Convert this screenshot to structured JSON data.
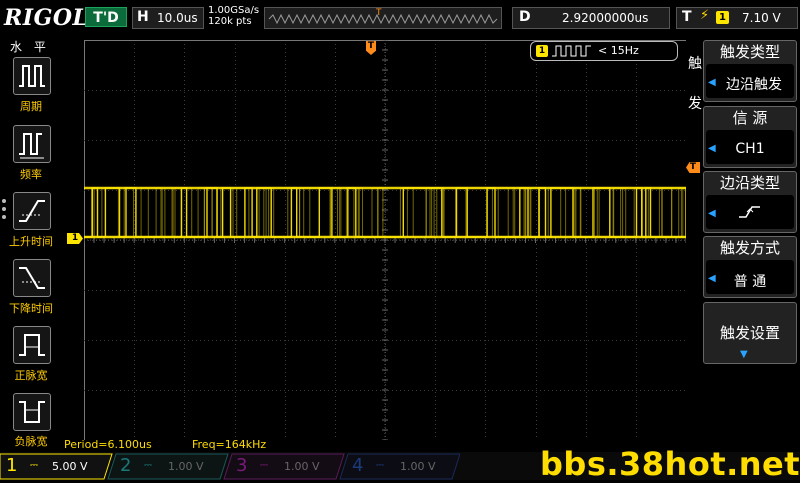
{
  "header": {
    "brand": "RIGOL",
    "run_status": "T'D",
    "hscale_letter": "H",
    "hscale_value": "10.0us",
    "sample_rate": "1.00GSa/s",
    "memory_points": "120k pts",
    "trigger_pos_marker": "T",
    "delay_letter": "D",
    "delay_value": "2.92000000us",
    "trigger_letter": "T",
    "trigger_channel": "1",
    "trigger_level": "7.10 V"
  },
  "left_menu": {
    "title": "水 平",
    "items": [
      {
        "label": "周期",
        "icon": "period-icon"
      },
      {
        "label": "频率",
        "icon": "frequency-icon"
      },
      {
        "label": "上升时间",
        "icon": "rise-time-icon"
      },
      {
        "label": "下降时间",
        "icon": "fall-time-icon"
      },
      {
        "label": "正脉宽",
        "icon": "positive-width-icon"
      },
      {
        "label": "负脉宽",
        "icon": "negative-width-icon"
      }
    ]
  },
  "screen": {
    "ch1_marker": "1",
    "trigger_time_marker": "T",
    "trigger_level_marker": "T",
    "counter": {
      "channel": "1",
      "value": "< 15Hz"
    }
  },
  "right_menu": {
    "vertical_label": "触\n发",
    "panels": [
      {
        "title": "触发类型",
        "value": "边沿触发"
      },
      {
        "title": "信 源",
        "value": "CH1"
      },
      {
        "title": "边沿类型",
        "value": ""
      },
      {
        "title": "触发方式",
        "value": "普 通"
      },
      {
        "title": "触发设置",
        "value": ""
      }
    ]
  },
  "measurements": {
    "period": "Period=6.100us",
    "freq": "Freq=164kHz"
  },
  "channels": [
    {
      "num": "1",
      "scale": "5.00 V",
      "color": "#ffe600",
      "active": true
    },
    {
      "num": "2",
      "scale": "1.00 V",
      "color": "#1a7a7a",
      "active": false
    },
    {
      "num": "3",
      "scale": "1.00 V",
      "color": "#7a1a7a",
      "active": false
    },
    {
      "num": "4",
      "scale": "1.00 V",
      "color": "#1a3a7a",
      "active": false
    }
  ],
  "watermark": "bbs.38hot.net",
  "colors": {
    "ch1": "#ffe600",
    "trigger": "#ff8c1a",
    "accent": "#29a3ff"
  }
}
